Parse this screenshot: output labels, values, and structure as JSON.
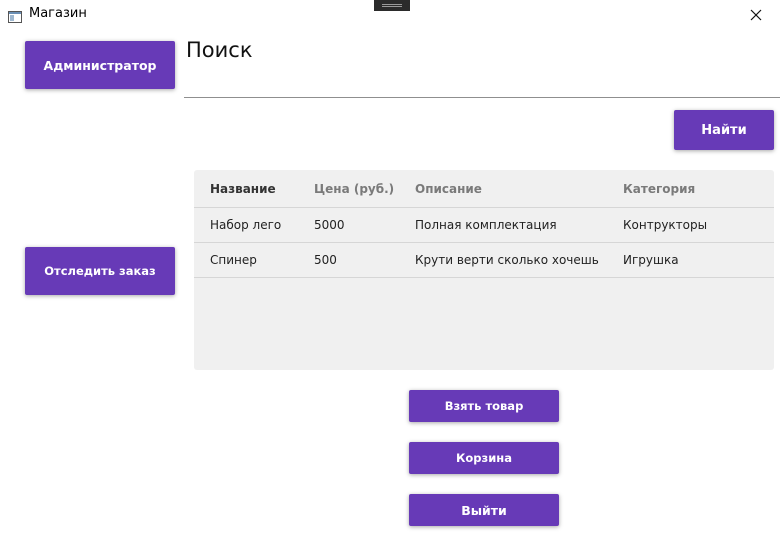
{
  "window": {
    "title": "Магазин",
    "icon": "window-app-icon",
    "close_icon": "close-icon"
  },
  "sidebar": {
    "admin_button": "Администратор",
    "track_order_button": "Отследить заказ"
  },
  "search": {
    "label": "Поиск",
    "value": "",
    "placeholder": "",
    "find_button": "Найти"
  },
  "table": {
    "columns": [
      "Название",
      "Цена (руб.)",
      "Описание",
      "Категория"
    ],
    "rows": [
      [
        "Набор лего",
        "5000",
        "Полная комплектация",
        "Контрукторы"
      ],
      [
        "Спинер",
        "500",
        "Крути верти сколько хочешь",
        "Игрушка"
      ]
    ]
  },
  "actions": {
    "take_item": "Взять товар",
    "cart": "Корзина",
    "exit": "Выйти"
  },
  "colors": {
    "accent": "#673ab7",
    "grid_background": "#f0f0f0"
  }
}
